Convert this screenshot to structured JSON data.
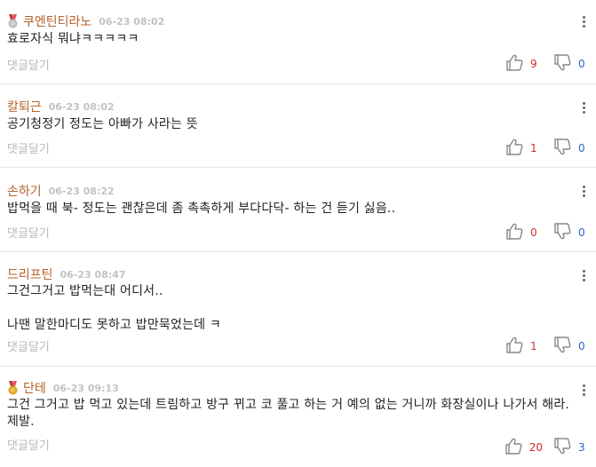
{
  "comments": [
    {
      "nickname": "쿠엔틴티라노",
      "date": "06-23 08:02",
      "medal": "silver",
      "body": "효로자식 뭐냐ㅋㅋㅋㅋㅋ",
      "reply_label": "댓글달기",
      "up": "9",
      "down": "0"
    },
    {
      "nickname": "칼퇴근",
      "date": "06-23 08:02",
      "medal": null,
      "body": "공기청정기 정도는 아빠가 사라는 뜻",
      "reply_label": "댓글달기",
      "up": "1",
      "down": "0"
    },
    {
      "nickname": "손하기",
      "date": "06-23 08:22",
      "medal": null,
      "body": "밥먹을 때 북- 정도는 괜찮은데 좀 촉촉하게 부다다닥- 하는 건 듣기 싫음..",
      "reply_label": "댓글달기",
      "up": "0",
      "down": "0"
    },
    {
      "nickname": "드리프틴",
      "date": "06-23 08:47",
      "medal": null,
      "body": "그건그거고 밥먹는대 어디서..\n\n나땐 말한마디도 못하고 밥만묵었는데 ㅋ",
      "reply_label": "댓글달기",
      "up": "1",
      "down": "0"
    },
    {
      "nickname": "단테",
      "date": "06-23 09:13",
      "medal": "gold",
      "body": "그건 그거고 밥 먹고 있는데 트림하고 방구 뀌고 코 풀고 하는 거 예의 없는 거니까 화장실이나 나가서 해라. 제발.",
      "reply_label": "댓글달기",
      "up": "20",
      "down": "3"
    }
  ],
  "icons": {
    "thumb_up": "thumb-up-icon",
    "thumb_down": "thumb-down-icon",
    "more": "more-vertical-icon",
    "medal": "medal-icon"
  },
  "colors": {
    "nickname": "#b5632a",
    "date": "#c2c2c2",
    "up_count": "#d42b2b",
    "down_count": "#2b63c9",
    "reply": "#b8b8b8"
  }
}
